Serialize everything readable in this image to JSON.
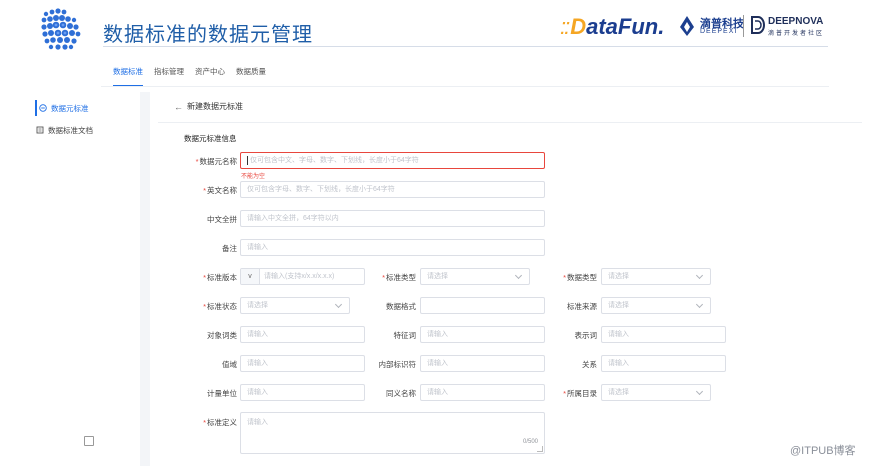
{
  "slide": {
    "title": "数据标准的数据元管理",
    "brand_datafun_dots": "::",
    "brand_datafun_d": "D",
    "brand_datafun_rest": "ataFun.",
    "brand_deepexi_cn": "滴普科技",
    "brand_deepexi_en": "DEEPEXI",
    "brand_deepnova": "DEEPNOVA",
    "brand_deepnova_sub": "滴普开发者社区"
  },
  "top_tabs": [
    "数据标准",
    "指标管理",
    "资产中心",
    "数据质量"
  ],
  "active_top_tab": 0,
  "sidebar": {
    "items": [
      {
        "label": "数据元标准",
        "icon": "circle-minus-icon",
        "active": true
      },
      {
        "label": "数据标准文档",
        "icon": "document-icon",
        "active": false
      }
    ]
  },
  "page": {
    "back_label": "新建数据元标准",
    "section_title": "数据元标准信息"
  },
  "fields": {
    "name": {
      "label": "数据元名称",
      "required": true,
      "placeholder": "仅可包含中文、字母、数字、下划线，长度小于64字符",
      "error": "不能为空"
    },
    "english_name": {
      "label": "英文名称",
      "required": true,
      "placeholder": "仅可包含字母、数字、下划线，长度小于64字符"
    },
    "pinyin": {
      "label": "中文全拼",
      "required": false,
      "placeholder": "请输入中文全拼，64字符以内"
    },
    "note": {
      "label": "备注",
      "required": false,
      "placeholder": "请输入"
    },
    "version": {
      "label": "标准版本",
      "required": true,
      "prefix": "v",
      "placeholder": "请输入(支持x/x.x/x.x.x)"
    },
    "std_type": {
      "label": "标准类型",
      "required": true,
      "placeholder": "请选择"
    },
    "data_type": {
      "label": "数据类型",
      "required": true,
      "placeholder": "请选择"
    },
    "std_status": {
      "label": "标准状态",
      "required": true,
      "placeholder": "请选择"
    },
    "data_format": {
      "label": "数据格式",
      "required": false,
      "placeholder": ""
    },
    "std_source": {
      "label": "标准来源",
      "required": false,
      "placeholder": "请选择"
    },
    "object_word": {
      "label": "对象词类",
      "required": false,
      "placeholder": "请输入"
    },
    "feature_word": {
      "label": "特征词",
      "required": false,
      "placeholder": "请输入"
    },
    "express_word": {
      "label": "表示词",
      "required": false,
      "placeholder": "请输入"
    },
    "value_domain": {
      "label": "值域",
      "required": false,
      "placeholder": "请输入"
    },
    "internal_id": {
      "label": "内部标识符",
      "required": false,
      "placeholder": "请输入"
    },
    "relation": {
      "label": "关系",
      "required": false,
      "placeholder": "请输入"
    },
    "unit": {
      "label": "计量单位",
      "required": false,
      "placeholder": "请输入"
    },
    "synonym": {
      "label": "同义名称",
      "required": false,
      "placeholder": "请输入"
    },
    "catalog": {
      "label": "所属目录",
      "required": true,
      "placeholder": "请选择"
    },
    "definition": {
      "label": "标准定义",
      "required": true,
      "placeholder": "请输入",
      "counter": "0/500"
    }
  },
  "watermark": "@ITPUB博客",
  "colors": {
    "accent": "#1f6fe5",
    "error": "#e8463d",
    "title": "#1f5ea8"
  }
}
